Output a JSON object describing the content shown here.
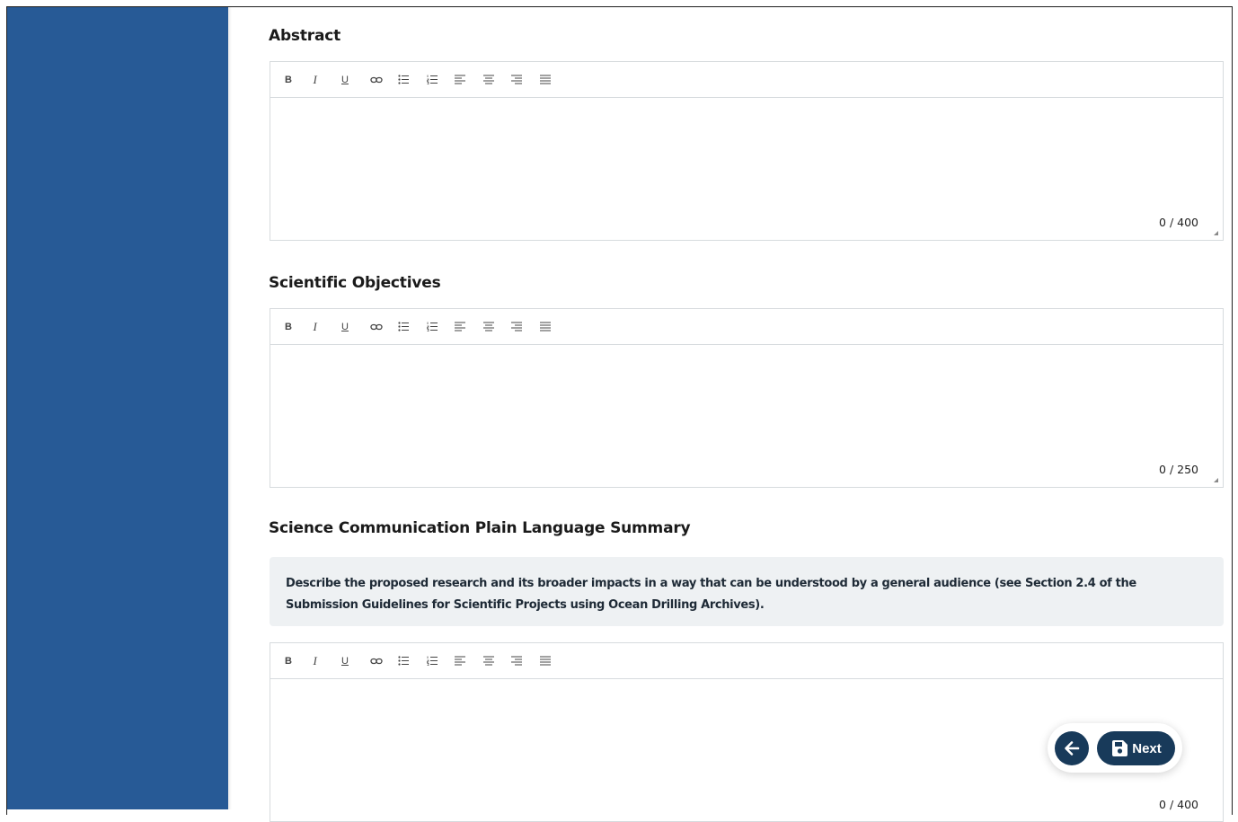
{
  "sections": [
    {
      "title": "Abstract",
      "counter": "0 / 400"
    },
    {
      "title": "Scientific Objectives",
      "counter": "0 / 250"
    },
    {
      "title": "Science Communication Plain Language Summary",
      "counter": "0 / 400"
    }
  ],
  "toolbar": {
    "items": [
      {
        "name": "bold",
        "label": "B"
      },
      {
        "name": "italic",
        "label": "I"
      },
      {
        "name": "underline",
        "label": "U"
      },
      {
        "name": "link-icon"
      },
      {
        "name": "bullet-list-icon"
      },
      {
        "name": "numbered-list-icon"
      },
      {
        "name": "align-left-icon"
      },
      {
        "name": "align-center-icon"
      },
      {
        "name": "align-right-icon"
      },
      {
        "name": "align-justify-icon"
      }
    ]
  },
  "notice": {
    "text": "Describe the proposed research and its broader impacts in a way that can be understood by a general audience (see Section 2.4 of the Submission Guidelines for Scientific Projects using Ocean Drilling Archives)."
  },
  "nav": {
    "next_label": "Next",
    "back_icon": "arrow-left-icon",
    "save_icon": "floppy-disk-icon"
  },
  "colors": {
    "sidebar": "#275a96",
    "button": "#183a5a",
    "notice_bg": "#eef1f3",
    "border": "#d7dbde"
  }
}
